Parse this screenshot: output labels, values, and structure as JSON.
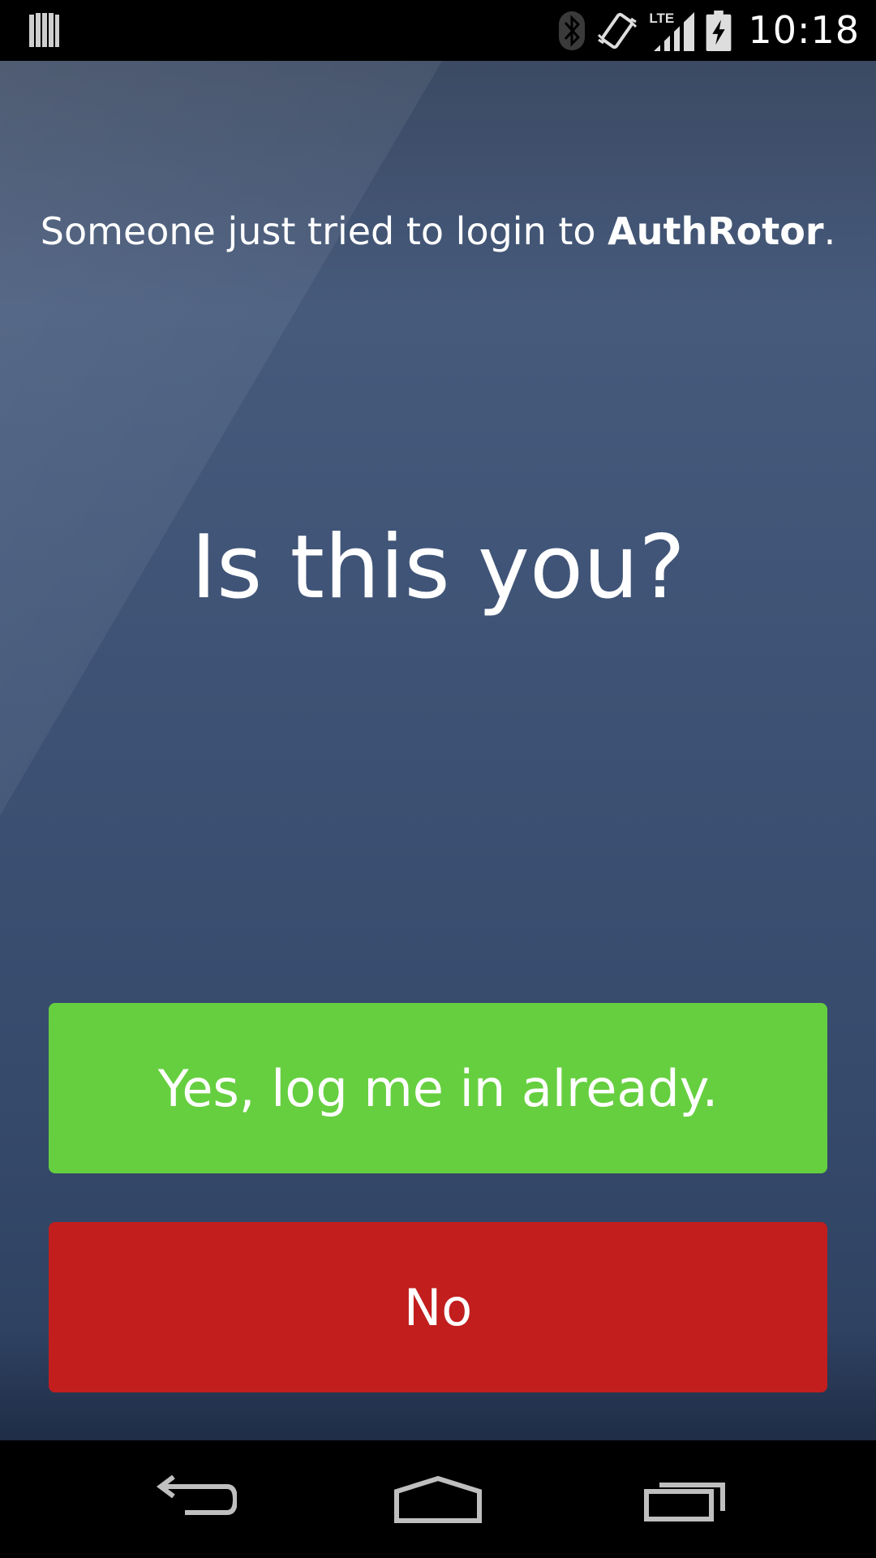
{
  "status_bar": {
    "time": "10:18",
    "icons": [
      "notification-icon",
      "bluetooth-icon",
      "vibrate-icon",
      "lte-signal-icon",
      "battery-charging-icon"
    ],
    "network_label": "LTE"
  },
  "prompt": {
    "subtitle_prefix": "Someone just tried to login to ",
    "app_name": "AuthRotor",
    "subtitle_suffix": ".",
    "headline": "Is this you?"
  },
  "actions": {
    "yes_label": "Yes, log me in already.",
    "no_label": "No"
  },
  "nav_bar": {
    "icons": [
      "back-icon",
      "home-icon",
      "recents-icon"
    ]
  },
  "colors": {
    "background": "#3e5275",
    "yes_button": "#66cf40",
    "no_button": "#c21e1e",
    "text": "#ffffff"
  }
}
